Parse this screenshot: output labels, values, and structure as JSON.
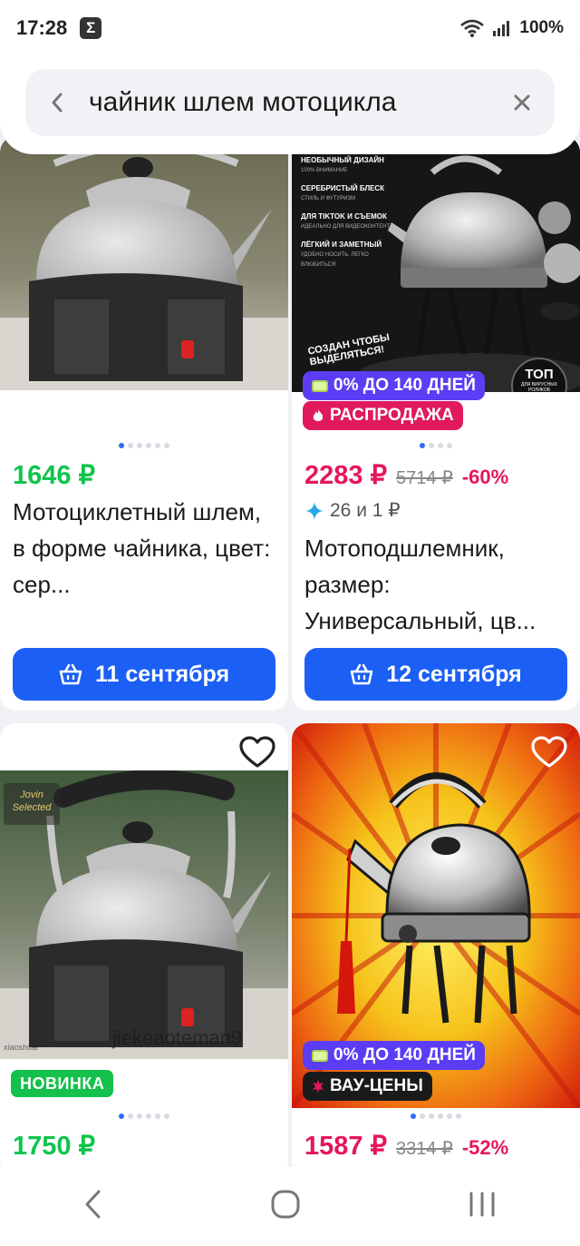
{
  "status_bar": {
    "time": "17:28",
    "app_badge": "Σ",
    "battery": "100%"
  },
  "search": {
    "query": "чайник шлем мотоцикла"
  },
  "products": [
    {
      "price": "1646 ₽",
      "title": "Мотоциклетный шлем, в форме чайника, цвет: сер...",
      "delivery": "11 сентября"
    },
    {
      "price": "2283 ₽",
      "old_price": "5714 ₽",
      "discount": "-60%",
      "rating_text": "26 и 1 ₽",
      "title": "Мотоподшлемник, размер: Универсальный, цв...",
      "delivery": "12 сентября",
      "badges": [
        "0% ДО 140 ДНЕЙ",
        "РАСПРОДАЖА"
      ],
      "image_texts": {
        "f1_title": "НЕОБЫЧНЫЙ ДИЗАЙН",
        "f1_sub": "100% ВНИМАНИЕ",
        "f2_title": "СЕРЕБРИСТЫЙ БЛЕСК",
        "f2_sub": "СТИЛЬ И ФУТУРИЗМ",
        "f3_title": "ДЛЯ TIKTOK И СЪЕМОК",
        "f3_sub": "ИДЕАЛЬНО ДЛЯ ВИДЕОКОНТЕНТА",
        "f4_title": "ЛЁГКИЙ И ЗАМЕТНЫЙ",
        "f4_sub": "УДОБНО НОСИТЬ, ЛЕГКО ВЛЮБИТЬСЯ",
        "slogan": "СОЗДАН ЧТОБЫ ВЫДЕЛЯТЬСЯ!",
        "top": "ТОП",
        "top_sub": "ДЛЯ ВИРУСНЫХ РОЛИКОВ"
      }
    },
    {
      "price": "1750 ₽",
      "badge_new": "НОВИНКА",
      "image_texts": {
        "watermark": "jiekeaoteman9",
        "small_mark": "xiaoshuai",
        "logo": "Jovin Selected"
      }
    },
    {
      "price": "1587 ₽",
      "old_price": "3314 ₽",
      "discount": "-52%",
      "badges": [
        "0% ДО 140 ДНЕЙ",
        "ВАУ-ЦЕНЫ"
      ]
    }
  ],
  "icons": {
    "wifi": "wifi-icon",
    "signal": "signal-icon",
    "back": "chevron-left-icon",
    "clear": "close-icon",
    "basket": "basket-icon",
    "heart": "heart-icon",
    "sparkle": "sparkle-icon",
    "fire": "fire-icon"
  },
  "colors": {
    "accent": "#1c5ff5",
    "price_green": "#10c44c",
    "price_pink": "#e6155f",
    "installment": "#5c3df5"
  }
}
